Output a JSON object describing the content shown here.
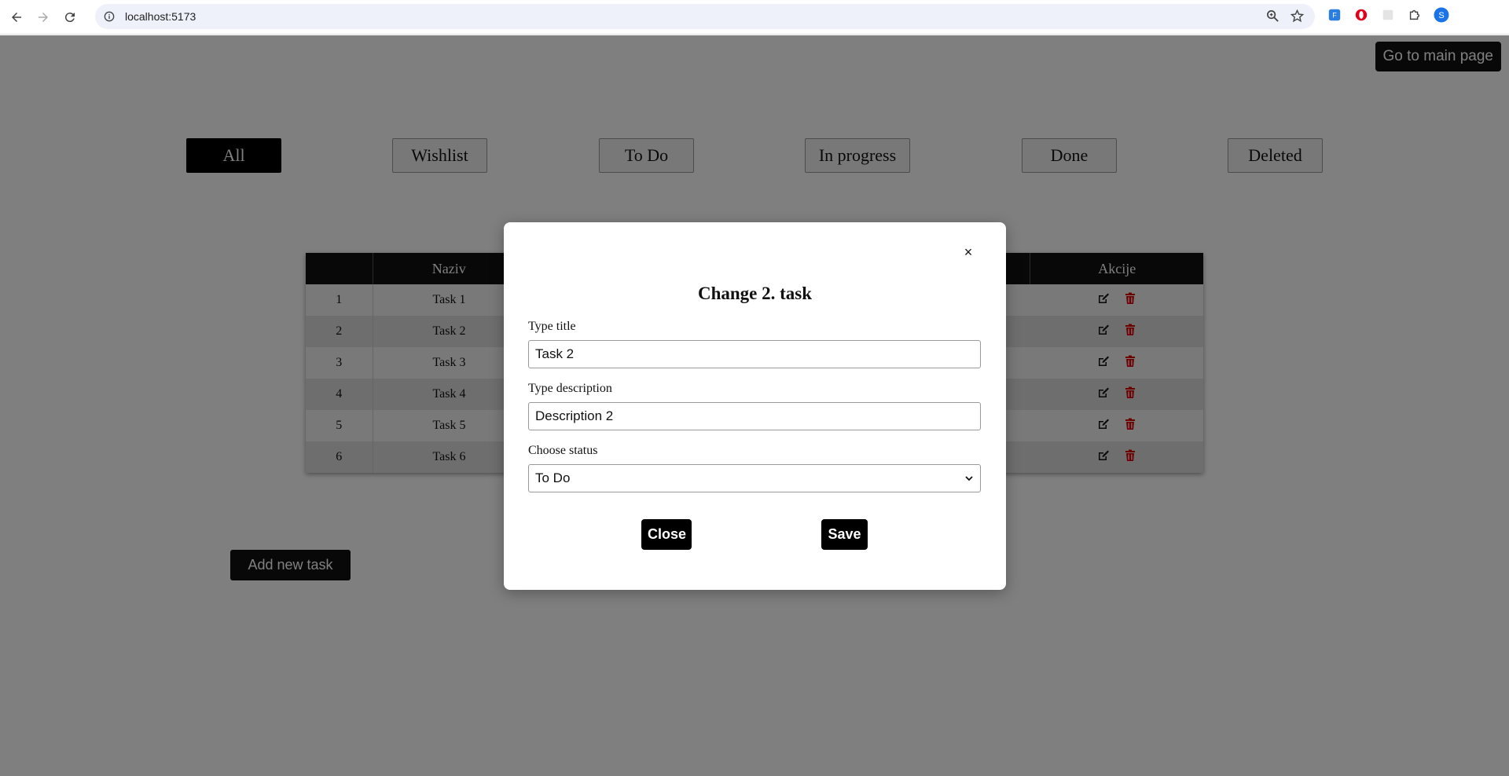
{
  "browser": {
    "url": "localhost:5173",
    "profile_initial": "S"
  },
  "header": {
    "main_page_label": "Go to main page"
  },
  "filters": [
    {
      "label": "All",
      "active": true
    },
    {
      "label": "Wishlist",
      "active": false
    },
    {
      "label": "To Do",
      "active": false
    },
    {
      "label": "In progress",
      "active": false
    },
    {
      "label": "Done",
      "active": false
    },
    {
      "label": "Deleted",
      "active": false
    }
  ],
  "table": {
    "columns": [
      "",
      "Naziv",
      "Akcije"
    ],
    "rows": [
      {
        "num": "1",
        "name": "Task 1"
      },
      {
        "num": "2",
        "name": "Task 2"
      },
      {
        "num": "3",
        "name": "Task 3"
      },
      {
        "num": "4",
        "name": "Task 4"
      },
      {
        "num": "5",
        "name": "Task 5"
      },
      {
        "num": "6",
        "name": "Task 6"
      }
    ]
  },
  "add_task_label": "Add new task",
  "modal": {
    "close_x": "×",
    "title": "Change 2. task",
    "title_label": "Type title",
    "title_value": "Task 2",
    "description_label": "Type description",
    "description_value": "Description 2",
    "status_label": "Choose status",
    "status_value": "To Do",
    "close_label": "Close",
    "save_label": "Save"
  },
  "colors": {
    "accent": "#000000",
    "delete": "#d90000",
    "overlay": "rgba(0,0,0,0.5)"
  }
}
